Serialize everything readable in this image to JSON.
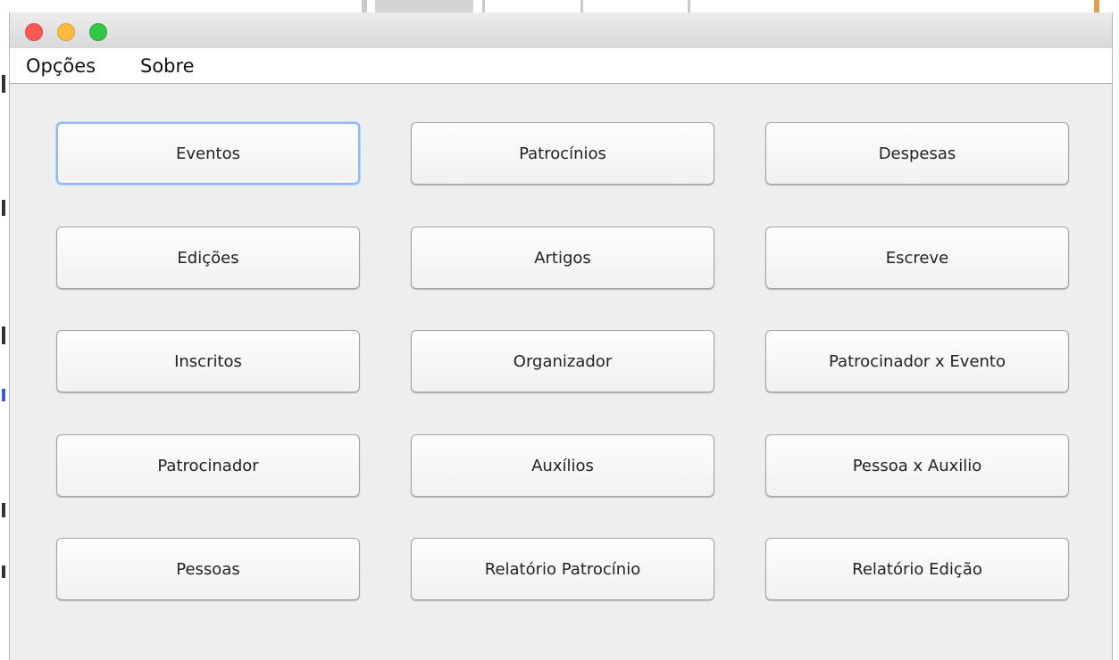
{
  "menubar": {
    "items": [
      "Opções",
      "Sobre"
    ]
  },
  "buttons": [
    {
      "label": "Eventos",
      "name": "eventos-button",
      "focused": true
    },
    {
      "label": "Patrocínios",
      "name": "patrocinios-button"
    },
    {
      "label": "Despesas",
      "name": "despesas-button"
    },
    {
      "label": "Edições",
      "name": "edicoes-button"
    },
    {
      "label": "Artigos",
      "name": "artigos-button"
    },
    {
      "label": "Escreve",
      "name": "escreve-button"
    },
    {
      "label": "Inscritos",
      "name": "inscritos-button"
    },
    {
      "label": "Organizador",
      "name": "organizador-button"
    },
    {
      "label": "Patrocinador x Evento",
      "name": "patrocinador-x-evento-button"
    },
    {
      "label": "Patrocinador",
      "name": "patrocinador-button"
    },
    {
      "label": "Auxílios",
      "name": "auxilios-button"
    },
    {
      "label": "Pessoa x Auxilio",
      "name": "pessoa-x-auxilio-button"
    },
    {
      "label": "Pessoas",
      "name": "pessoas-button"
    },
    {
      "label": "Relatório Patrocínio",
      "name": "relatorio-patrocinio-button"
    },
    {
      "label": "Relatório Edição",
      "name": "relatorio-edicao-button"
    }
  ],
  "colors": {
    "window_bg": "#eeeeee",
    "focus_ring": "#8fbaf0",
    "close": "#fc5753",
    "minimize": "#fdbc40",
    "maximize": "#33c748"
  }
}
